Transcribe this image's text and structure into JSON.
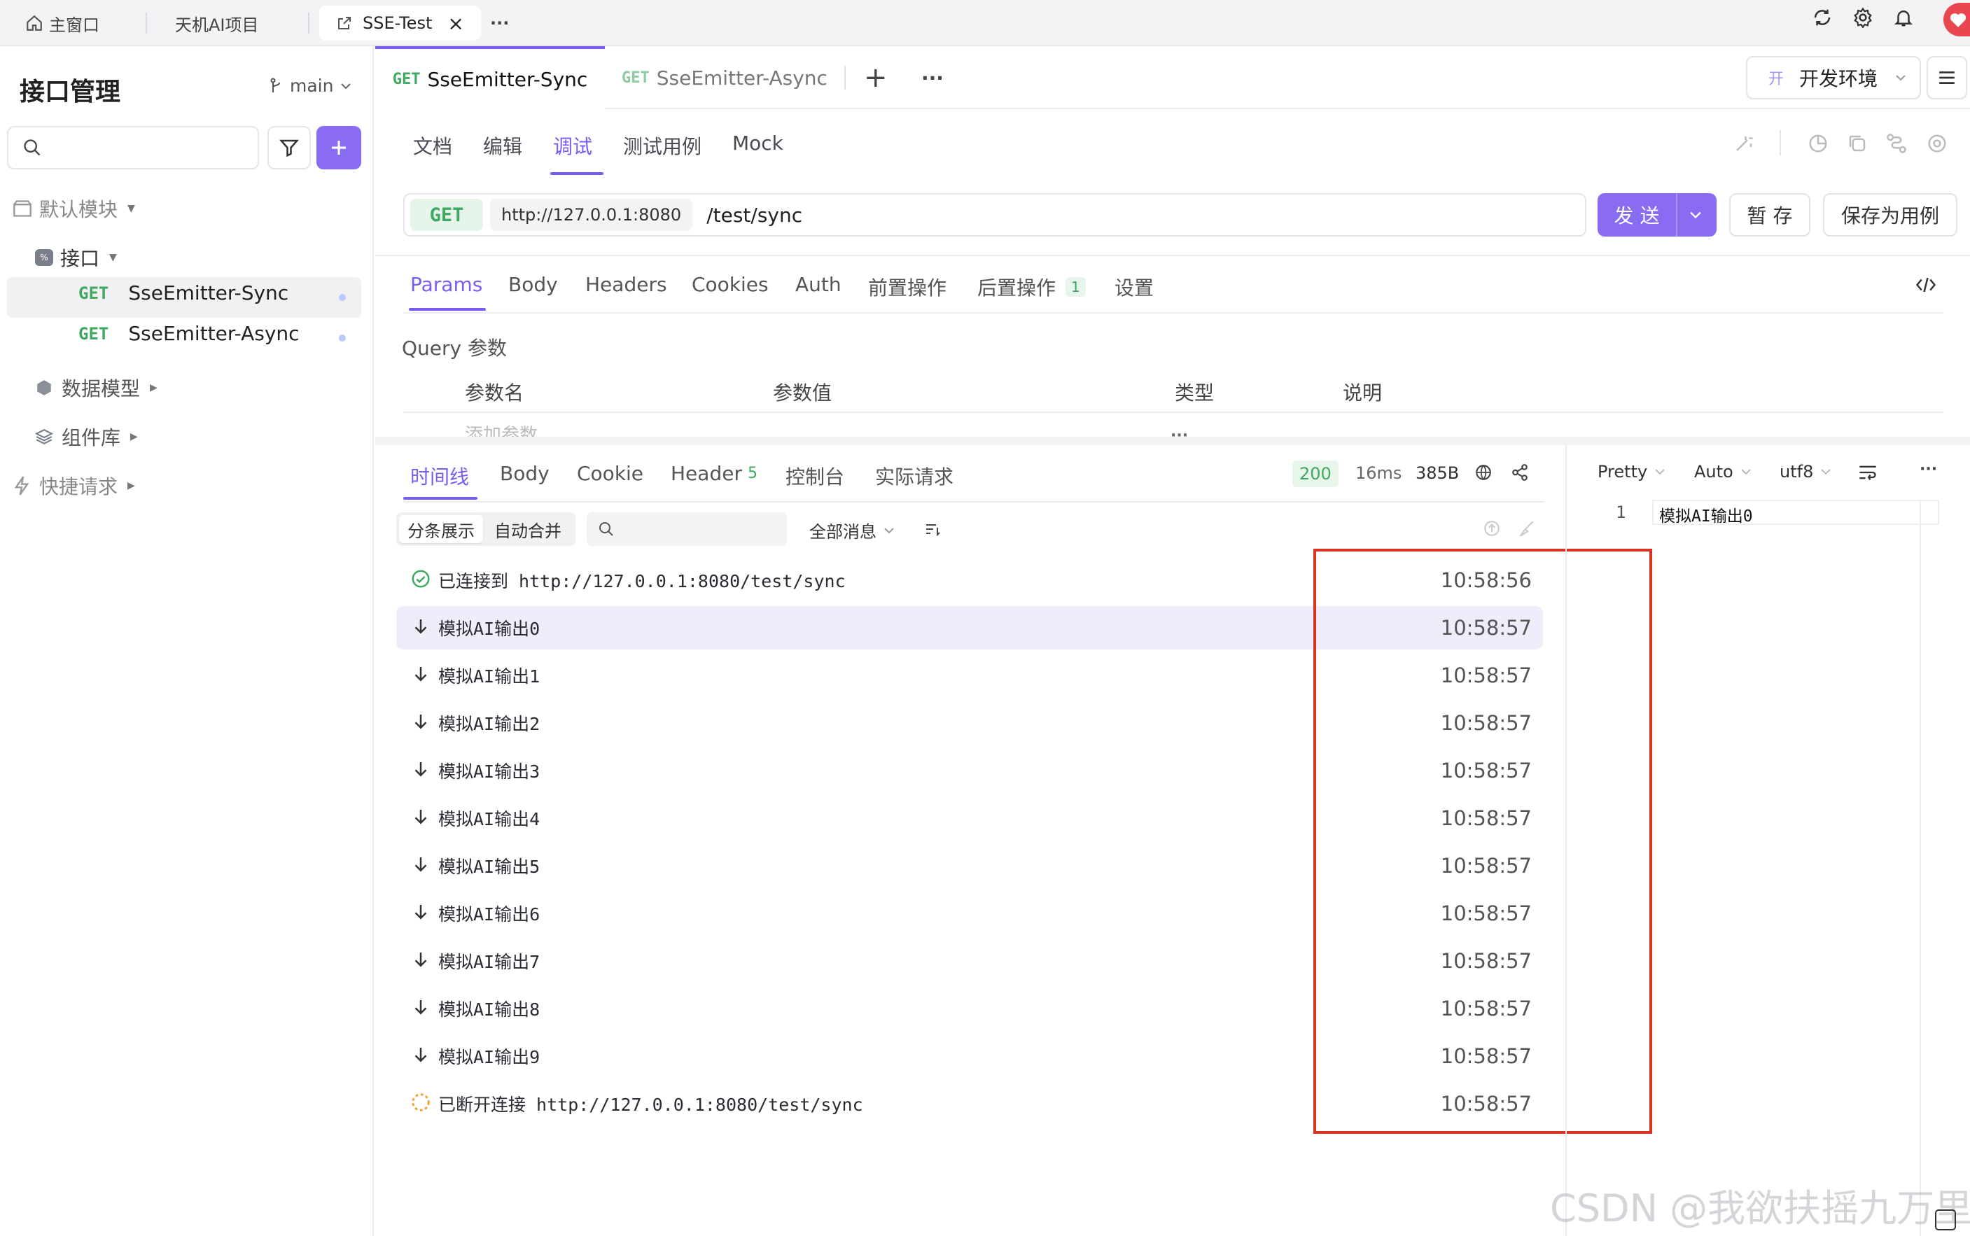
{
  "window_tabs": {
    "home": "主窗口",
    "project": "天机AI项目",
    "active": "SSE-Test",
    "close": "×",
    "more": "···"
  },
  "sidebar": {
    "title": "接口管理",
    "branch": "main",
    "search_placeholder": "",
    "items": [
      {
        "label": "默认模块"
      },
      {
        "label": "接口"
      },
      {
        "method": "GET",
        "label": "SseEmitter-Sync"
      },
      {
        "method": "GET",
        "label": "SseEmitter-Async"
      },
      {
        "label": "数据模型"
      },
      {
        "label": "组件库"
      },
      {
        "label": "快捷请求"
      }
    ]
  },
  "request_tabs": [
    {
      "method": "GET",
      "label": "SseEmitter-Sync"
    },
    {
      "method": "GET",
      "label": "SseEmitter-Async"
    }
  ],
  "request_tab_add": "+",
  "request_tab_more": "···",
  "env": {
    "badge": "开",
    "label": "开发环境"
  },
  "sub_tabs": [
    "文档",
    "编辑",
    "调试",
    "测试用例",
    "Mock"
  ],
  "url": {
    "method": "GET",
    "base": "http://127.0.0.1:8080",
    "path": "/test/sync"
  },
  "buttons": {
    "send": "发 送",
    "save_temp": "暂 存",
    "save_case": "保存为用例"
  },
  "param_tabs": [
    "Params",
    "Body",
    "Headers",
    "Cookies",
    "Auth",
    "前置操作",
    "后置操作",
    "设置"
  ],
  "param_tab_badge": "1",
  "query": {
    "title": "Query 参数",
    "headers": [
      "参数名",
      "参数值",
      "类型",
      "说明"
    ],
    "add_placeholder": "添加参数",
    "drag": "···"
  },
  "response": {
    "tabs": [
      "时间线",
      "Body",
      "Cookie",
      "Header",
      "控制台",
      "实际请求"
    ],
    "header_count": "5",
    "status": "200",
    "time": "16ms",
    "size": "385B",
    "view_buttons": [
      "分条展示",
      "自动合并"
    ],
    "filter": "全部消息",
    "events": [
      {
        "type": "connect",
        "text": "已连接到 http://127.0.0.1:8080/test/sync",
        "time": "10:58:56"
      },
      {
        "type": "message",
        "text": "模拟AI输出0",
        "time": "10:58:57"
      },
      {
        "type": "message",
        "text": "模拟AI输出1",
        "time": "10:58:57"
      },
      {
        "type": "message",
        "text": "模拟AI输出2",
        "time": "10:58:57"
      },
      {
        "type": "message",
        "text": "模拟AI输出3",
        "time": "10:58:57"
      },
      {
        "type": "message",
        "text": "模拟AI输出4",
        "time": "10:58:57"
      },
      {
        "type": "message",
        "text": "模拟AI输出5",
        "time": "10:58:57"
      },
      {
        "type": "message",
        "text": "模拟AI输出6",
        "time": "10:58:57"
      },
      {
        "type": "message",
        "text": "模拟AI输出7",
        "time": "10:58:57"
      },
      {
        "type": "message",
        "text": "模拟AI输出8",
        "time": "10:58:57"
      },
      {
        "type": "message",
        "text": "模拟AI输出9",
        "time": "10:58:57"
      },
      {
        "type": "disconnect",
        "text": "已断开连接 http://127.0.0.1:8080/test/sync",
        "time": "10:58:57"
      }
    ],
    "selected_index": 1
  },
  "detail": {
    "format": "Pretty",
    "mode": "Auto",
    "encoding": "utf8",
    "more": "···",
    "line_no": "1",
    "line": "模拟AI输出0"
  },
  "watermark": "CSDN @我欲扶摇九万里",
  "colors": {
    "accent": "#7b5cf0",
    "get": "#3fa962",
    "highlight_box": "#d8331f"
  }
}
